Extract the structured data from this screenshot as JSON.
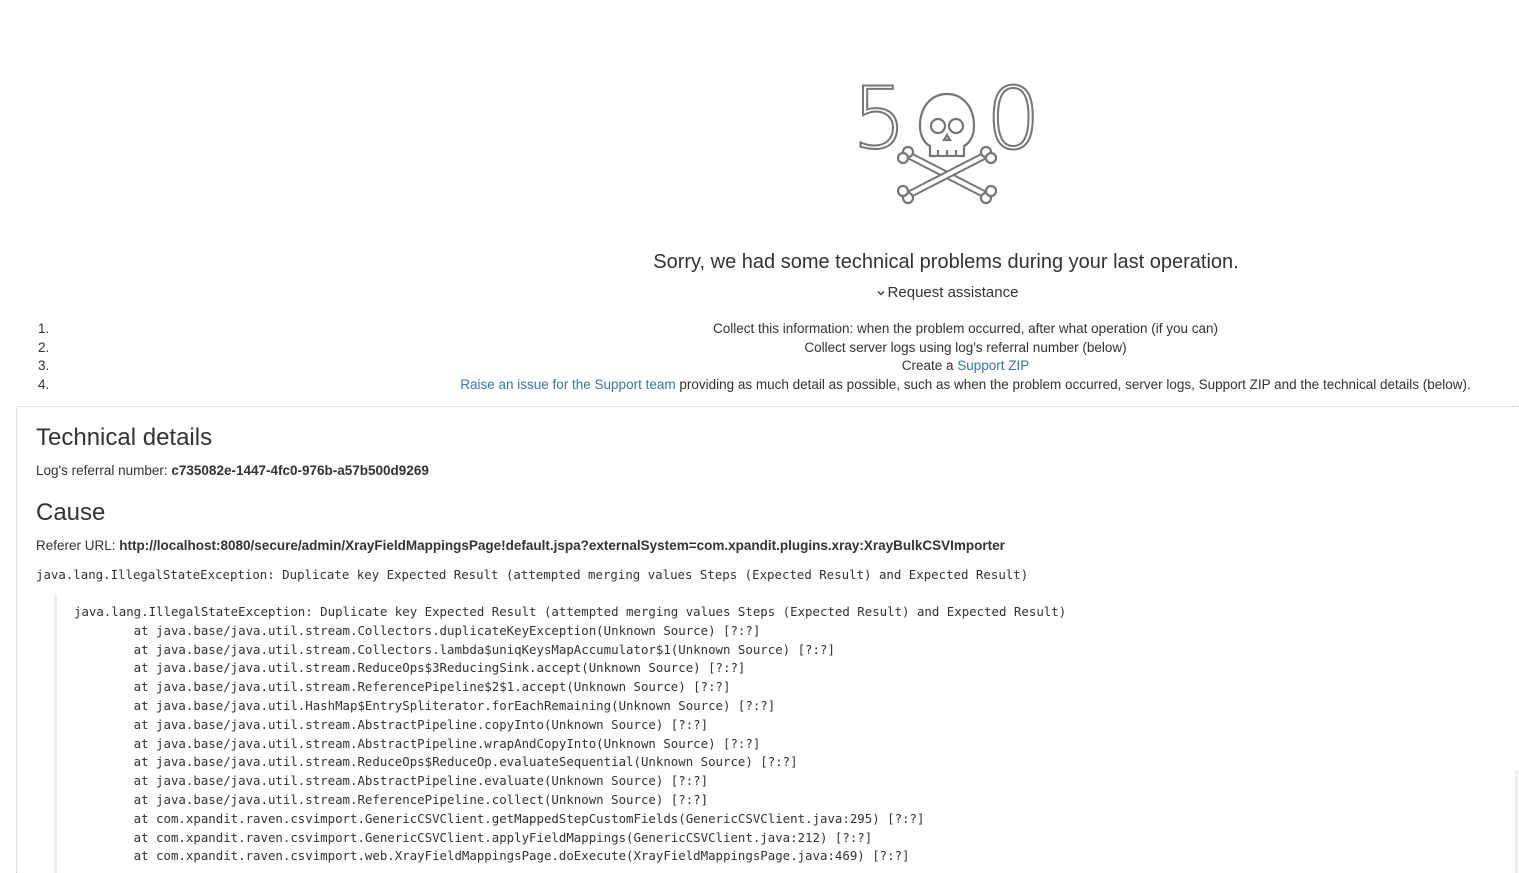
{
  "error": {
    "code_left": "5",
    "code_right": "0",
    "message": "Sorry, we had some technical problems during your last operation.",
    "request_assistance": "Request assistance"
  },
  "steps": [
    {
      "num": "1.",
      "text": "Collect this information: when the problem occurred, after what operation (if you can)"
    },
    {
      "num": "2.",
      "text": "Collect server logs using log's referral number (below)"
    },
    {
      "num": "3.",
      "prefix": "Create a ",
      "link": "Support ZIP"
    },
    {
      "num": "4.",
      "link": "Raise an issue for the Support team",
      "suffix": " providing as much detail as possible, such as when the problem occurred, server logs, Support ZIP and the technical details (below)."
    }
  ],
  "technical": {
    "title": "Technical details",
    "ref_label": "Log's referral number: ",
    "ref_value": "c735082e-1447-4fc0-976b-a57b500d9269"
  },
  "cause": {
    "title": "Cause",
    "referer_label": "Referer URL: ",
    "referer_value": "http://localhost:8080/secure/admin/XrayFieldMappingsPage!default.jspa?externalSystem=com.xpandit.plugins.xray:XrayBulkCSVImporter",
    "summary": "java.lang.IllegalStateException: Duplicate key Expected Result (attempted merging values Steps (Expected Result) and Expected Result)"
  },
  "stack_trace": [
    "java.lang.IllegalStateException: Duplicate key Expected Result (attempted merging values Steps (Expected Result) and Expected Result)",
    "\tat java.base/java.util.stream.Collectors.duplicateKeyException(Unknown Source) [?:?]",
    "\tat java.base/java.util.stream.Collectors.lambda$uniqKeysMapAccumulator$1(Unknown Source) [?:?]",
    "\tat java.base/java.util.stream.ReduceOps$3ReducingSink.accept(Unknown Source) [?:?]",
    "\tat java.base/java.util.stream.ReferencePipeline$2$1.accept(Unknown Source) [?:?]",
    "\tat java.base/java.util.HashMap$EntrySpliterator.forEachRemaining(Unknown Source) [?:?]",
    "\tat java.base/java.util.stream.AbstractPipeline.copyInto(Unknown Source) [?:?]",
    "\tat java.base/java.util.stream.AbstractPipeline.wrapAndCopyInto(Unknown Source) [?:?]",
    "\tat java.base/java.util.stream.ReduceOps$ReduceOp.evaluateSequential(Unknown Source) [?:?]",
    "\tat java.base/java.util.stream.AbstractPipeline.evaluate(Unknown Source) [?:?]",
    "\tat java.base/java.util.stream.ReferencePipeline.collect(Unknown Source) [?:?]",
    "\tat com.xpandit.raven.csvimport.GenericCSVClient.getMappedStepCustomFields(GenericCSVClient.java:295) [?:?]",
    "\tat com.xpandit.raven.csvimport.GenericCSVClient.applyFieldMappings(GenericCSVClient.java:212) [?:?]",
    "\tat com.xpandit.raven.csvimport.web.XrayFieldMappingsPage.doExecute(XrayFieldMappingsPage.java:469) [?:?]"
  ],
  "icons": {
    "skull": "skull-crossbones-icon",
    "chevron": "chevron-down-icon"
  },
  "colors": {
    "link": "#3b73af",
    "text": "#333333",
    "graphic": "#767676"
  }
}
